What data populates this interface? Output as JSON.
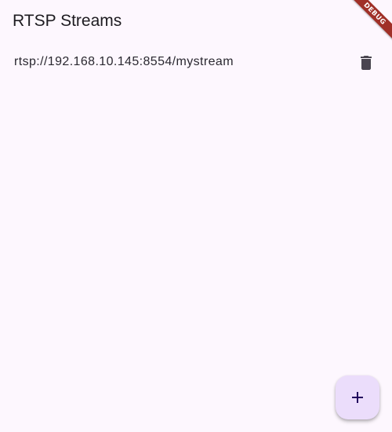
{
  "app_bar": {
    "title": "RTSP Streams"
  },
  "streams": [
    {
      "url": "rtsp://192.168.10.145:8554/mystream",
      "delete_icon": "trash-icon"
    }
  ],
  "fab": {
    "icon": "plus-icon"
  },
  "debug_banner": {
    "label": "DEBUG"
  },
  "colors": {
    "background": "#fdf7fe",
    "fab_background": "#ebddfb",
    "icon": "#49454f",
    "fab_icon": "#21005d",
    "debug_banner": "#a03028"
  }
}
